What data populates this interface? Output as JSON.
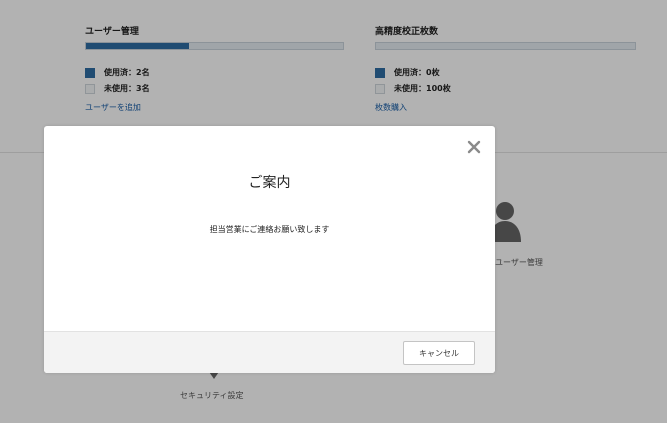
{
  "stats": {
    "users": {
      "title": "ユーザー管理",
      "progress_fraction": 0.4,
      "used_label": "使用済：2名",
      "unused_label": "未使用：3名",
      "link": "ユーザーを追加"
    },
    "certificates": {
      "title": "高精度校正枚数",
      "progress_fraction": 0.0,
      "used_label": "使用済：0枚",
      "unused_label": "未使用：100枚",
      "link": "枚数購入"
    }
  },
  "tiles": {
    "user_management": {
      "label": "ユーザー管理",
      "icon": "person-icon"
    },
    "security_settings": {
      "label": "セキュリティ設定",
      "icon": "shield-icon"
    }
  },
  "modal": {
    "title": "ご案内",
    "message": "担当営業にご連絡お願い致します",
    "cancel_label": "キャンセル",
    "close_icon": "close-icon"
  },
  "colors": {
    "accent": "#2e6da4",
    "link": "#1a5fa8",
    "overlay": "rgba(0,0,0,0.3)"
  }
}
